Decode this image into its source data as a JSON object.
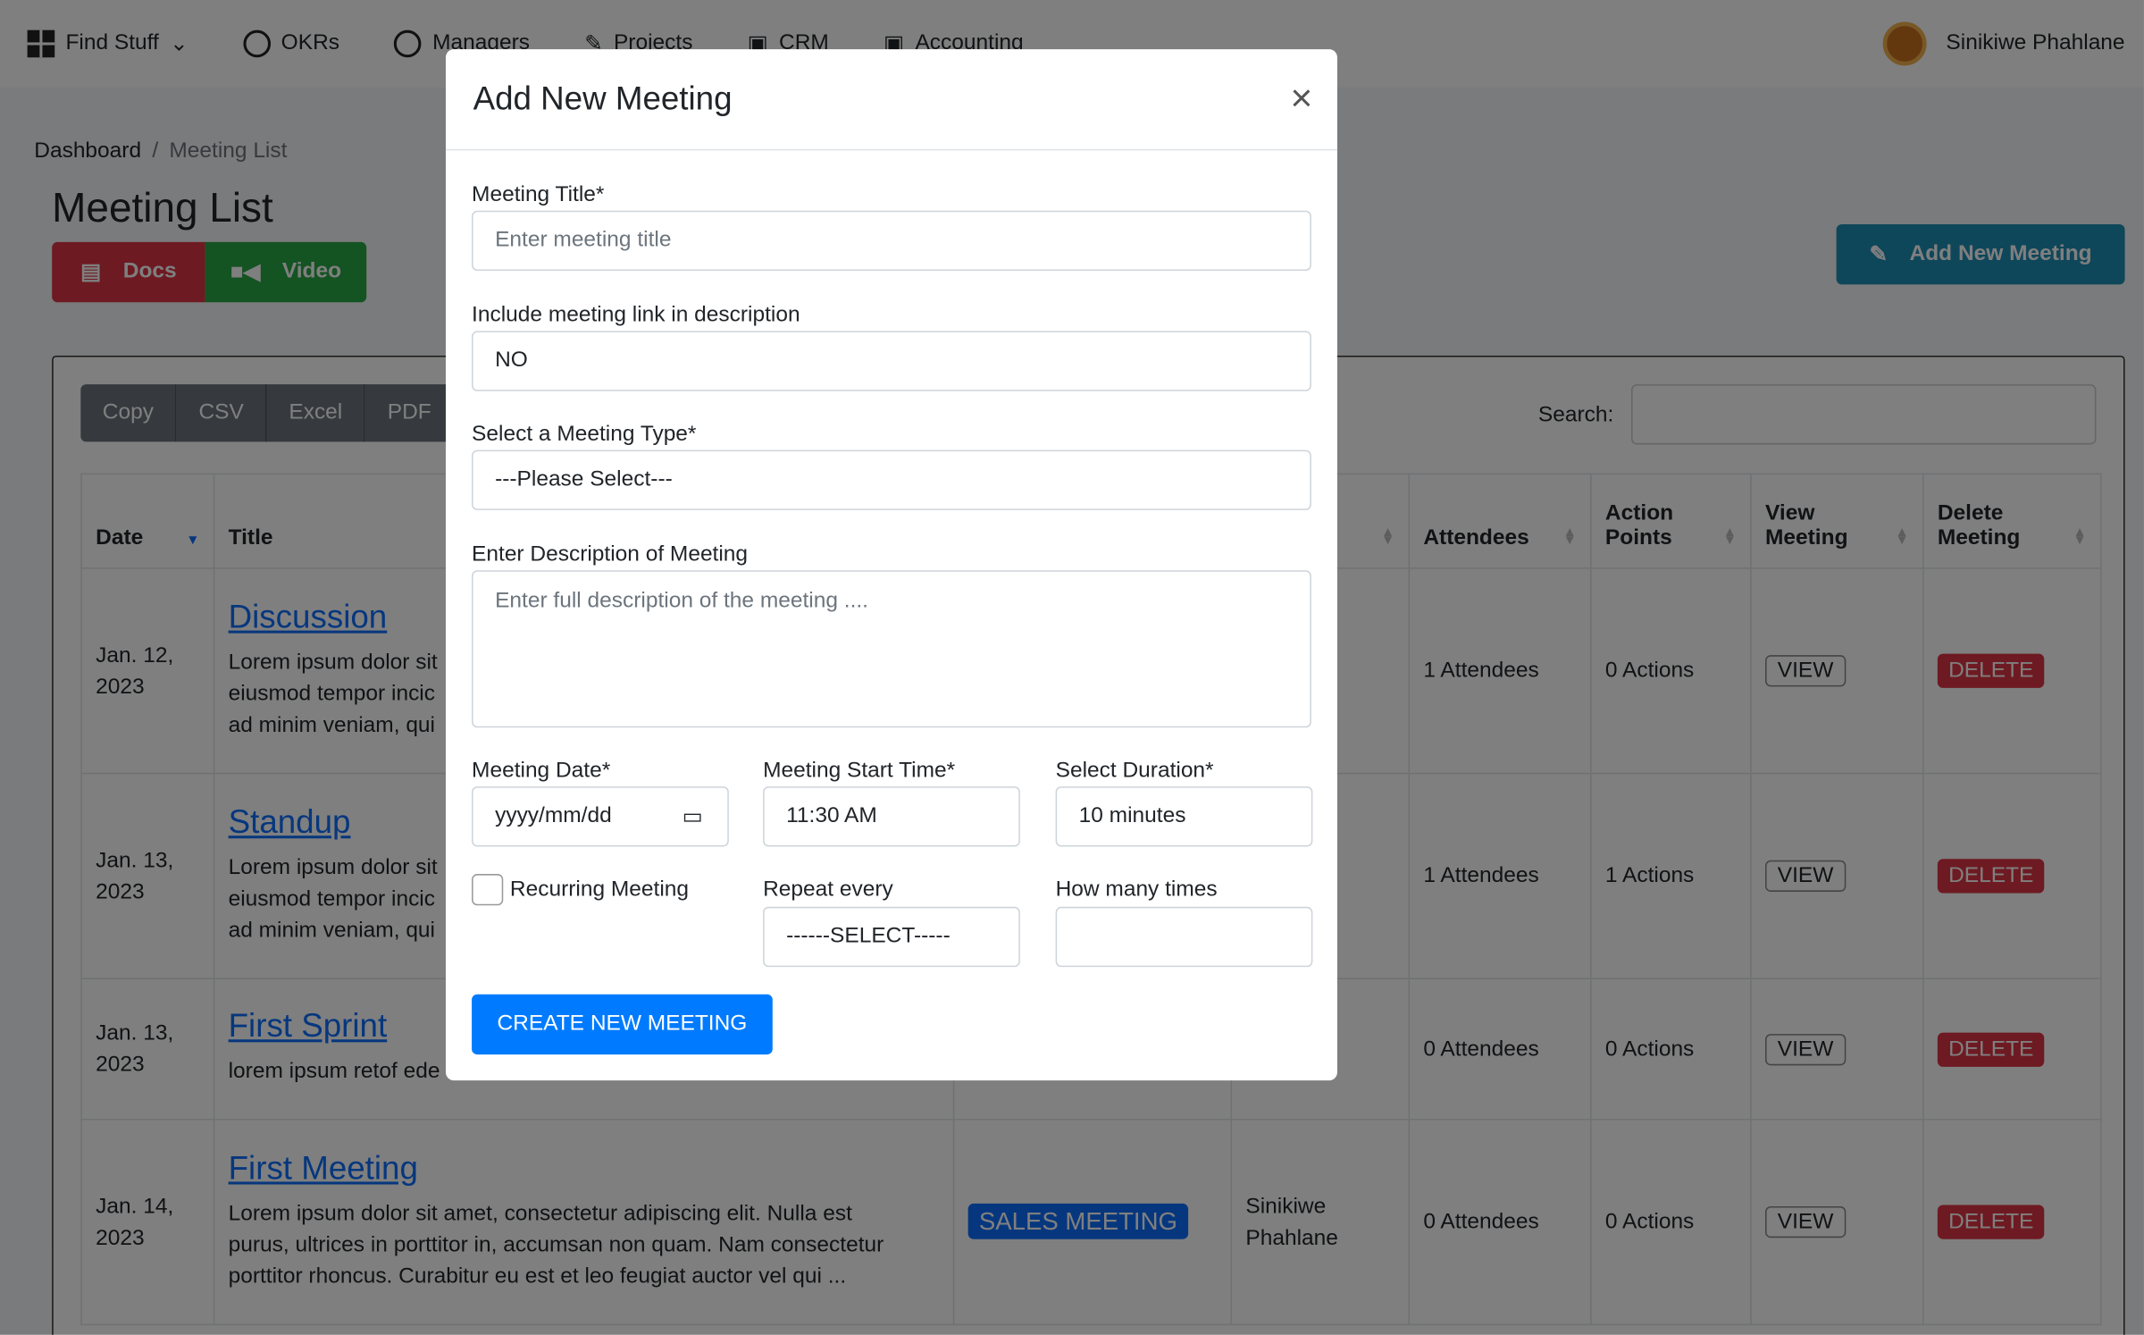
{
  "nav": {
    "items": [
      "Find Stuff",
      "OKRs",
      "Managers",
      "Projects",
      "CRM",
      "Accounting"
    ],
    "user": "Sinikiwe Phahlane"
  },
  "breadcrumb": {
    "home": "Dashboard",
    "sep": "/",
    "current": "Meeting List"
  },
  "page": {
    "title": "Meeting List",
    "docs": "Docs",
    "video": "Video",
    "add": "Add New Meeting"
  },
  "colors": {
    "docs": "#dc3545",
    "video": "#28a745",
    "add": "#1f8fb5",
    "primary": "#007bff",
    "danger": "#dc3545"
  },
  "toolbar": {
    "buttons": [
      "Copy",
      "CSV",
      "Excel",
      "PDF"
    ],
    "search_label": "Search:"
  },
  "table": {
    "headers": {
      "date": "Date",
      "title": "Title",
      "attendees": "Attendees",
      "action": [
        "Action",
        "Points"
      ],
      "view": [
        "View",
        "Meeting"
      ],
      "delete": [
        "Delete",
        "Meeting"
      ]
    },
    "rows": [
      {
        "date": [
          "Jan. 12,",
          "2023"
        ],
        "title": "Discussion",
        "desc": [
          "Lorem ipsum dolor sit",
          "eiusmod tempor incic",
          "ad minim veniam, qui"
        ],
        "type": "",
        "host": [
          "",
          ""
        ],
        "attendees": "1 Attendees",
        "actions": "0 Actions"
      },
      {
        "date": [
          "Jan. 13,",
          "2023"
        ],
        "title": "Standup",
        "desc": [
          "Lorem ipsum dolor sit",
          "eiusmod tempor incic",
          "ad minim veniam, qui"
        ],
        "type": "",
        "host": [
          "",
          ""
        ],
        "attendees": "1 Attendees",
        "actions": "1 Actions"
      },
      {
        "date": [
          "Jan. 13,",
          "2023"
        ],
        "title": "First Sprint",
        "desc": [
          "lorem ipsum retof ede"
        ],
        "type": "",
        "host": [
          "",
          ""
        ],
        "attendees": "0 Attendees",
        "actions": "0 Actions"
      },
      {
        "date": [
          "Jan. 14,",
          "2023"
        ],
        "title": "First Meeting",
        "desc": [
          "Lorem ipsum dolor sit amet, consectetur adipiscing elit. Nulla est",
          "purus, ultrices in porttitor in, accumsan non quam. Nam consectetur",
          "porttitor rhoncus. Curabitur eu est et leo feugiat auctor vel qui ..."
        ],
        "type": "SALES MEETING",
        "host": [
          "Sinikiwe",
          "Phahlane"
        ],
        "attendees": "0 Attendees",
        "actions": "0 Actions"
      }
    ],
    "view": "VIEW",
    "delete": "DELETE"
  },
  "modal": {
    "title": "Add New Meeting",
    "close": "×",
    "title_label": "Meeting Title*",
    "title_placeholder": "Enter meeting title",
    "link_label": "Include meeting link in description",
    "link_value": "NO",
    "type_label": "Select a Meeting Type*",
    "type_value": "---Please Select---",
    "desc_label": "Enter Description of Meeting",
    "desc_placeholder": "Enter full description of the meeting ....",
    "date_label": "Meeting Date*",
    "date_value": "yyyy/mm/dd",
    "time_label": "Meeting Start Time*",
    "time_value": "11:30 AM",
    "duration_label": "Select Duration*",
    "duration_value": "10 minutes",
    "recurring_label": "Recurring Meeting",
    "recurring_checked": false,
    "repeat_label": "Repeat every",
    "repeat_value": "------SELECT-----",
    "times_label": "How many times",
    "times_value": "",
    "submit": "CREATE NEW MEETING"
  }
}
